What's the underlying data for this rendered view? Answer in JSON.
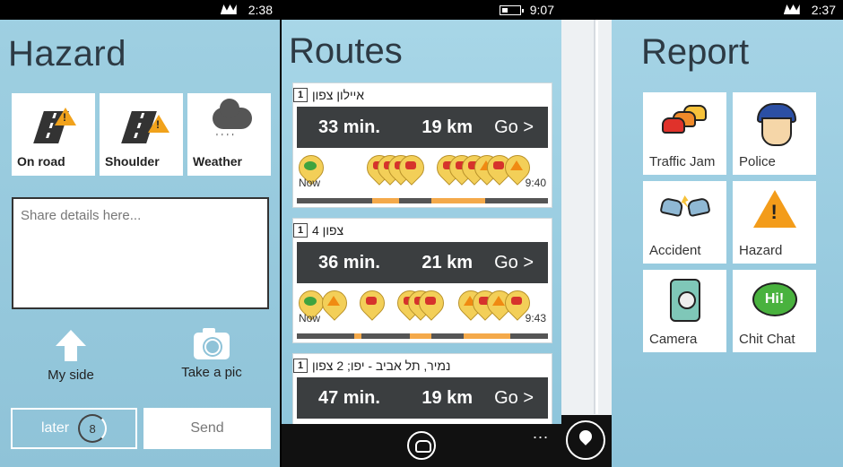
{
  "hazard": {
    "status": {
      "time": "2:38"
    },
    "title": "Hazard",
    "tiles": [
      {
        "label": "On road",
        "icon": "road-hazard-icon"
      },
      {
        "label": "Shoulder",
        "icon": "shoulder-hazard-icon"
      },
      {
        "label": "Weather",
        "icon": "weather-cloud-icon"
      }
    ],
    "share_placeholder": "Share details here...",
    "my_side_label": "My side",
    "take_pic_label": "Take a pic",
    "later_label": "later",
    "later_count": "8",
    "send_label": "Send"
  },
  "routes": {
    "status": {
      "time": "9:07"
    },
    "title": "Routes",
    "cards": [
      {
        "num": "1",
        "name": "איילון צפון",
        "time": "33 min.",
        "distance": "19 km",
        "go": "Go >",
        "start": "Now",
        "eta": "9:40"
      },
      {
        "num": "1",
        "name": "צפון 4",
        "time": "36 min.",
        "distance": "21 km",
        "go": "Go >",
        "start": "Now",
        "eta": "9:43"
      },
      {
        "num": "1",
        "name": "נמיר, תל אביב - יפו; 2 צפון",
        "time": "47 min.",
        "distance": "19 km",
        "go": "Go >"
      }
    ],
    "more_label": "..."
  },
  "report": {
    "status": {
      "time": "2:37"
    },
    "title": "Report",
    "tiles": [
      {
        "label": "Traffic Jam",
        "icon": "traffic-jam-icon"
      },
      {
        "label": "Police",
        "icon": "police-icon"
      },
      {
        "label": "Accident",
        "icon": "accident-icon"
      },
      {
        "label": "Hazard",
        "icon": "hazard-icon"
      },
      {
        "label": "Camera",
        "icon": "camera-icon"
      },
      {
        "label": "Chit Chat",
        "icon": "chit-chat-icon"
      }
    ]
  }
}
